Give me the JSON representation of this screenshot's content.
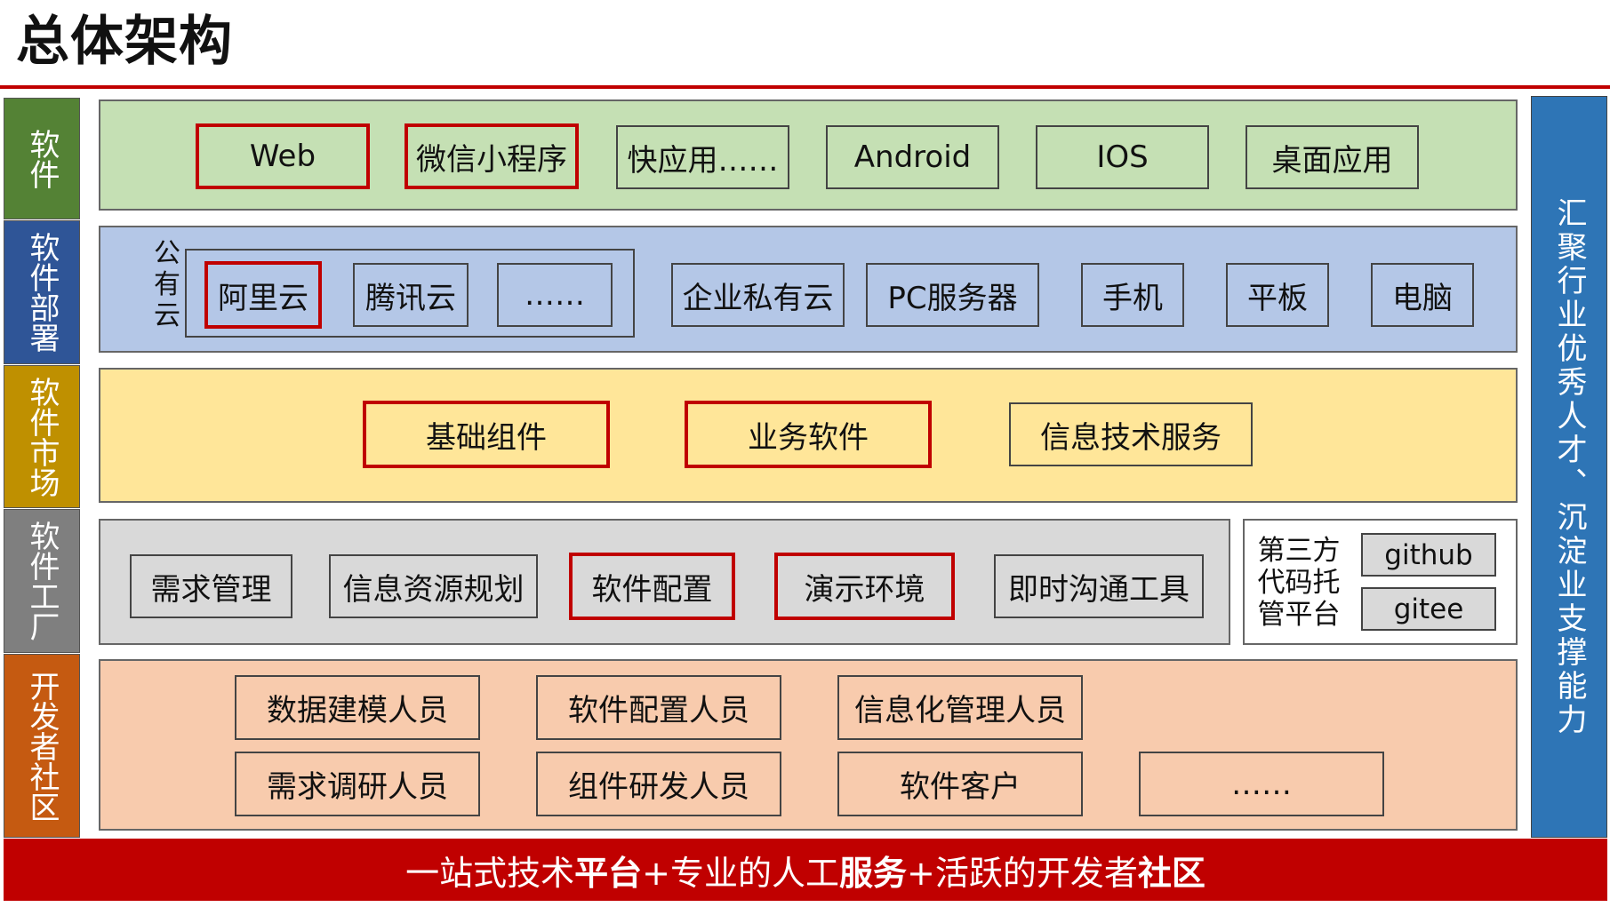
{
  "title": "总体架构",
  "side_labels": [
    "软件",
    "软件部署",
    "软件市场",
    "软件工厂",
    "开发者社区"
  ],
  "right_label": "汇聚行业优秀人才、沉淀业支撑能力",
  "row1": [
    "Web",
    "微信小程序",
    "快应用……",
    "Android",
    "IOS",
    "桌面应用"
  ],
  "row2": {
    "public_cloud_label": "公有云",
    "public_cloud_items": [
      "阿里云",
      "腾讯云",
      "……"
    ],
    "items": [
      "企业私有云",
      "PC服务器",
      "手机",
      "平板",
      "电脑"
    ]
  },
  "row3": [
    "基础组件",
    "业务软件",
    "信息技术服务"
  ],
  "row4": {
    "items": [
      "需求管理",
      "信息资源规划",
      "软件配置",
      "演示环境",
      "即时沟通工具"
    ],
    "hosting_label": "第三方代码托管平台",
    "hosting_items": [
      "github",
      "gitee"
    ]
  },
  "row5": {
    "line1": [
      "数据建模人员",
      "软件配置人员",
      "信息化管理人员"
    ],
    "line2": [
      "需求调研人员",
      "组件研发人员",
      "软件客户",
      "……"
    ]
  },
  "bottom": {
    "p1": "一站式技术",
    "b1": "平台",
    "p2": "+专业的人工",
    "b2": "服务",
    "p3": "+活跃的开发者",
    "b3": "社区"
  },
  "colors": {
    "accent": "#c00000",
    "software": "#548235",
    "deploy": "#2f5597",
    "market": "#bf9000",
    "factory": "#7f7f7f",
    "community": "#c55a11",
    "row1_bg": "#c5e0b4",
    "row2_bg": "#b4c7e7",
    "row3_bg": "#ffe699",
    "row4_bg": "#d9d9d9",
    "row5_bg": "#f8cbad",
    "right_bg": "#2e75b6"
  }
}
